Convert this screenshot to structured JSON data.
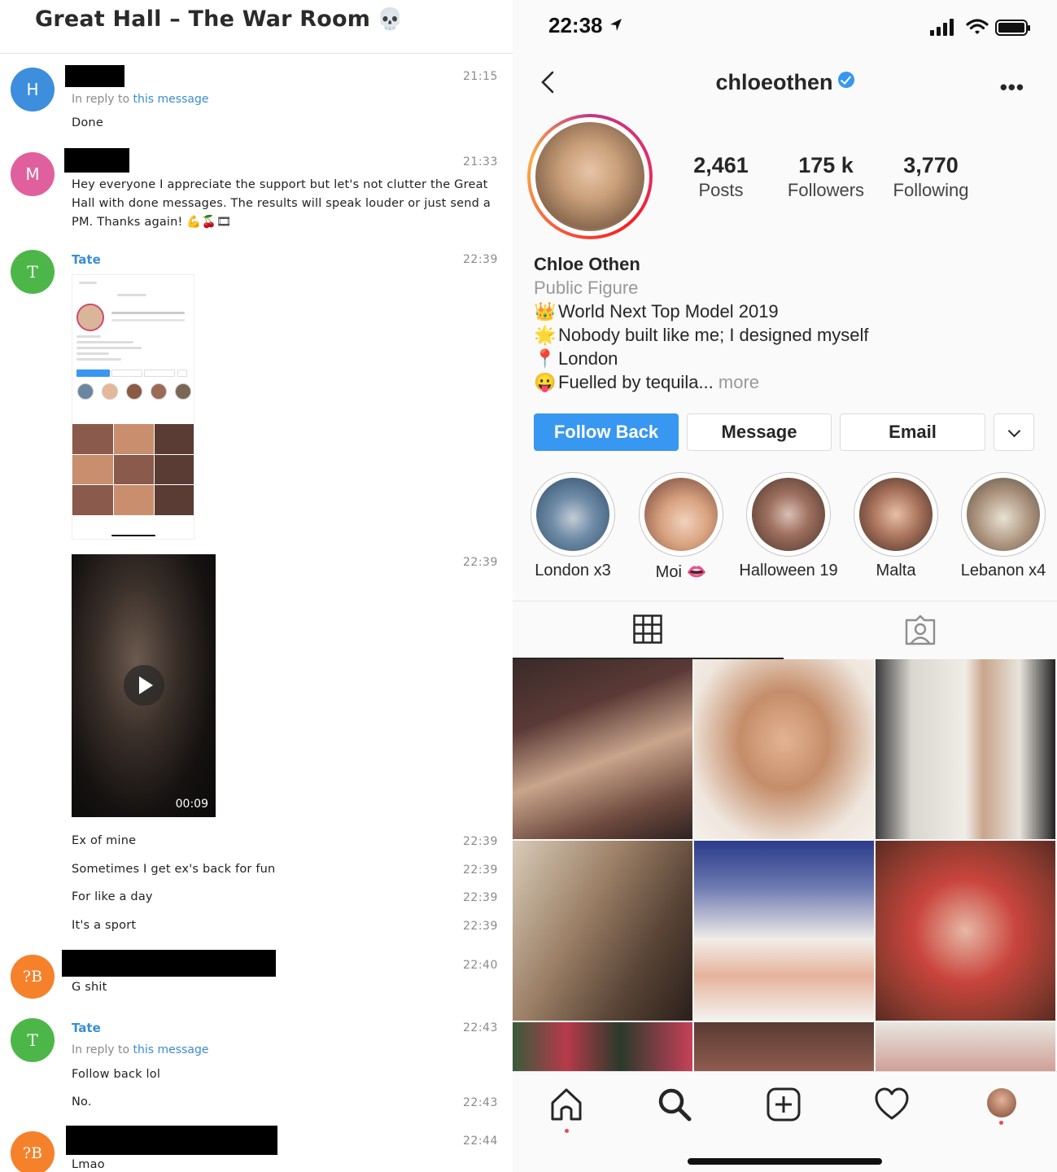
{
  "chat": {
    "title": "Great Hall – The War Room",
    "title_emoji": "💀",
    "messages": [
      {
        "avatar": "H",
        "time": "21:15",
        "reply_prefix": "In reply to",
        "reply_link": "this message",
        "text": "Done"
      },
      {
        "avatar": "M",
        "time": "21:33",
        "text": "Hey everyone I appreciate the support but let's not clutter the Great Hall with done messages. The results will speak louder or just send a PM. Thanks again! 💪🍒🎞"
      },
      {
        "avatar": "T",
        "sender": "Tate",
        "time": "22:39"
      },
      {
        "time": "22:39",
        "video_duration": "00:09"
      },
      {
        "time": "22:39",
        "text": "Ex of mine"
      },
      {
        "time": "22:39",
        "text": "Sometimes I get ex's back for fun"
      },
      {
        "time": "22:39",
        "text": "For like a day"
      },
      {
        "time": "22:39",
        "text": "It's a sport"
      },
      {
        "avatar": "?B",
        "time": "22:40",
        "text": "G shit"
      },
      {
        "avatar": "T",
        "sender": "Tate",
        "time": "22:43",
        "reply_prefix": "In reply to",
        "reply_link": "this message",
        "text": "Follow back lol"
      },
      {
        "time": "22:43",
        "text": "No."
      },
      {
        "avatar": "?B",
        "time": "22:44",
        "text": "Lmao"
      }
    ],
    "colors": {
      "blue": "#3d8edc",
      "pink": "#e0609d",
      "green": "#4cb748",
      "orange": "#f5812b",
      "link": "#3a8dd4"
    }
  },
  "instagram": {
    "status_time": "22:38",
    "username": "chloeothen",
    "stats": [
      {
        "value": "2,461",
        "label": "Posts"
      },
      {
        "value": "175 k",
        "label": "Followers"
      },
      {
        "value": "3,770",
        "label": "Following"
      }
    ],
    "name": "Chloe Othen",
    "category": "Public Figure",
    "bio": [
      {
        "emoji": "👑",
        "text": "World Next Top Model 2019"
      },
      {
        "emoji": "🌟",
        "text": "Nobody built like me; I designed myself"
      },
      {
        "emoji": "📍",
        "text": "London"
      },
      {
        "emoji": "😛",
        "text": "Fuelled by tequila...",
        "more": "more"
      }
    ],
    "buttons": {
      "follow": "Follow Back",
      "message": "Message",
      "email": "Email"
    },
    "highlights": [
      {
        "name": "London x3"
      },
      {
        "name": "Moi 👄"
      },
      {
        "name": "Halloween 19"
      },
      {
        "name": "Malta"
      },
      {
        "name": "Lebanon x4"
      }
    ],
    "accent": "#3897f0"
  }
}
